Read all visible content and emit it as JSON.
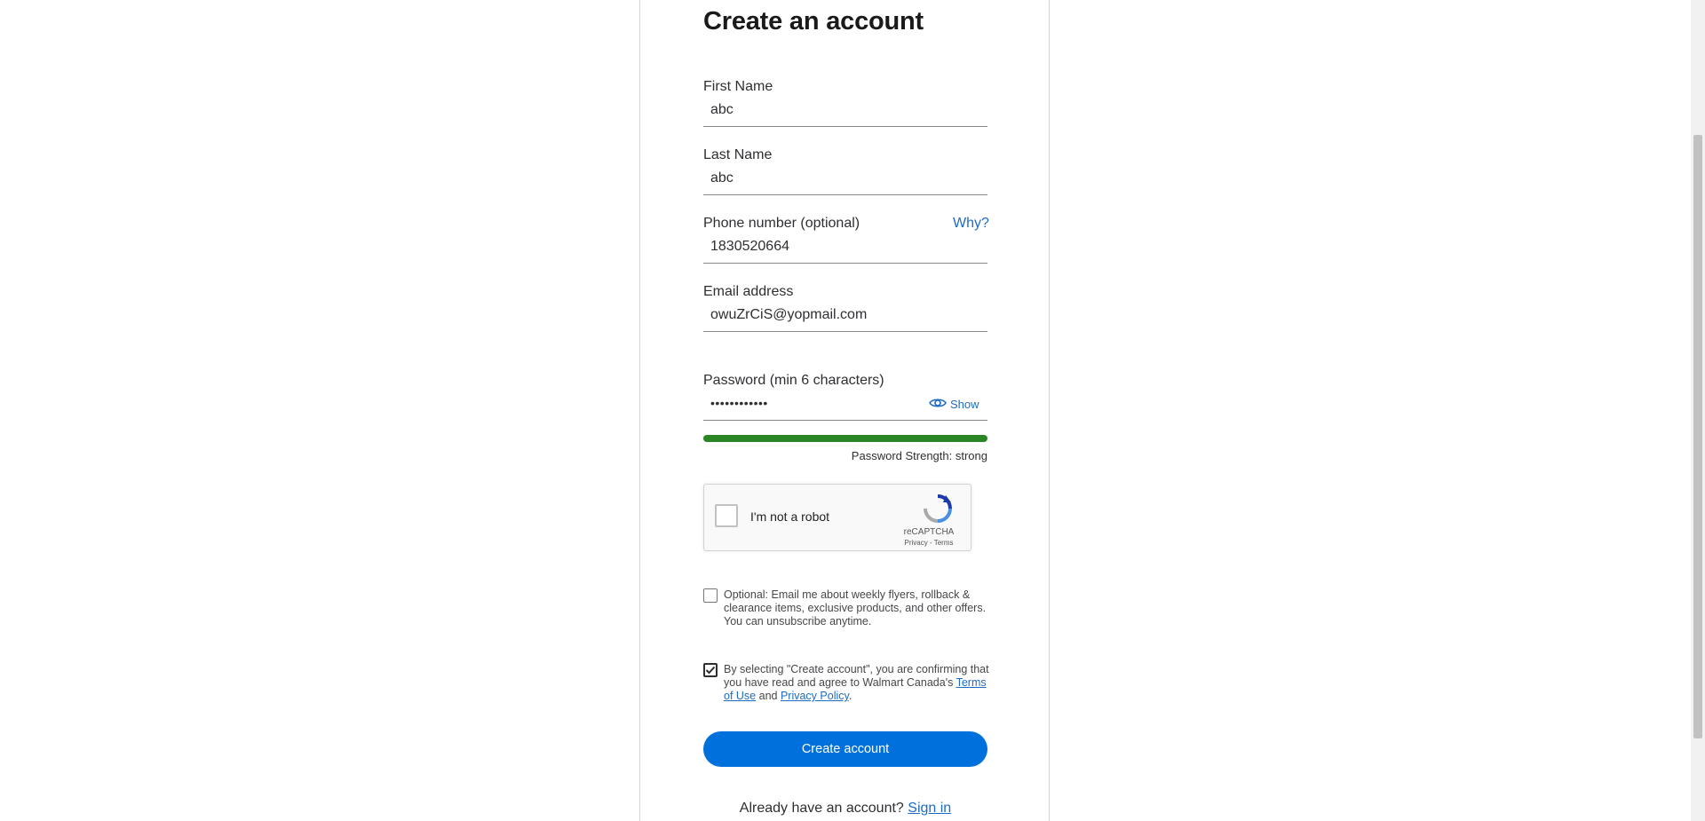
{
  "form": {
    "title": "Create an account",
    "first_name": {
      "label": "First Name",
      "value": "abc"
    },
    "last_name": {
      "label": "Last Name",
      "value": "abc"
    },
    "phone": {
      "label": "Phone number (optional)",
      "value": "1830520664",
      "why_link": "Why?"
    },
    "email": {
      "label": "Email address",
      "value": "owuZrCiS@yopmail.com"
    },
    "password": {
      "label": "Password (min 6 characters)",
      "masked_value": "••••••••••••",
      "show_label": "Show",
      "strength_text": "Password Strength: strong",
      "strength_fraction": 1.0
    },
    "recaptcha": {
      "label": "I'm not a robot",
      "brand": "reCAPTCHA",
      "privacy": "Privacy",
      "separator": " - ",
      "terms": "Terms"
    },
    "optin": {
      "checked": false,
      "text": "Optional: Email me about weekly flyers, rollback & clearance items, exclusive products, and other offers. You can unsubscribe anytime."
    },
    "consent": {
      "checked": true,
      "text_before": "By selecting \"Create account\", you are confirming that you have read and agree to Walmart Canada's ",
      "terms_link": "Terms of Use",
      "and": " and ",
      "privacy_link": "Privacy Policy",
      "period": "."
    },
    "submit_label": "Create account",
    "signin_prompt": "Already have an account? ",
    "signin_link": "Sign in"
  },
  "colors": {
    "accent": "#0071dc",
    "link": "#1d6cc4",
    "strength": "#2a8625"
  },
  "icons": {
    "show_password": "eye-icon",
    "recaptcha": "recaptcha-logo-icon",
    "checkmark": "checkmark-icon"
  }
}
